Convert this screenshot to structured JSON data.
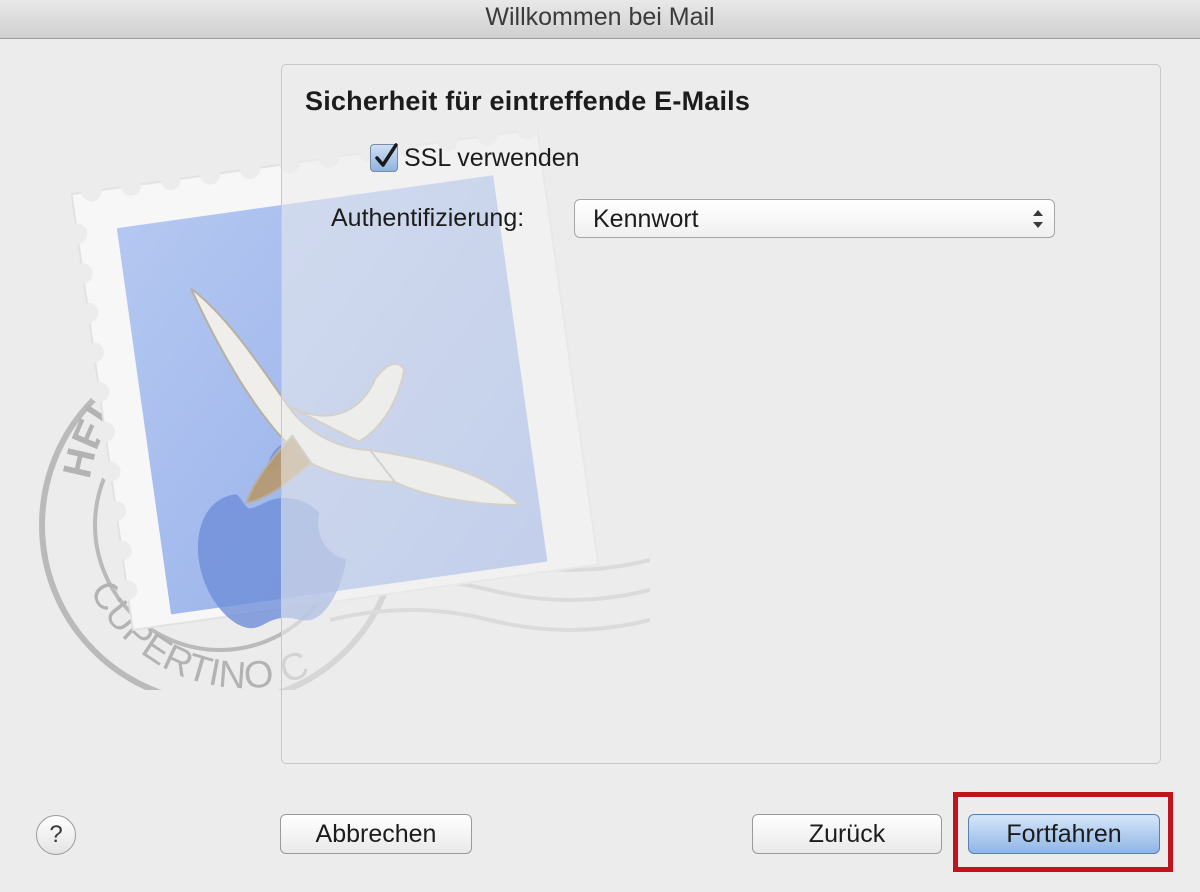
{
  "window": {
    "title": "Willkommen bei Mail"
  },
  "stamp": {
    "postmark_top_text": "HELLO FROM",
    "postmark_bottom_text": "CUPERTINO CA"
  },
  "incoming_security": {
    "heading": "Sicherheit für eintreffende E-Mails",
    "use_ssl": {
      "label": "SSL verwenden",
      "checked": true
    },
    "authentication": {
      "label": "Authentifizierung:",
      "selected": "Kennwort"
    }
  },
  "buttons": {
    "help": "?",
    "cancel": "Abbrechen",
    "back": "Zurück",
    "continue": "Fortfahren"
  },
  "colors": {
    "highlight": "#c0141c",
    "default_button": "#8fb6e6"
  }
}
